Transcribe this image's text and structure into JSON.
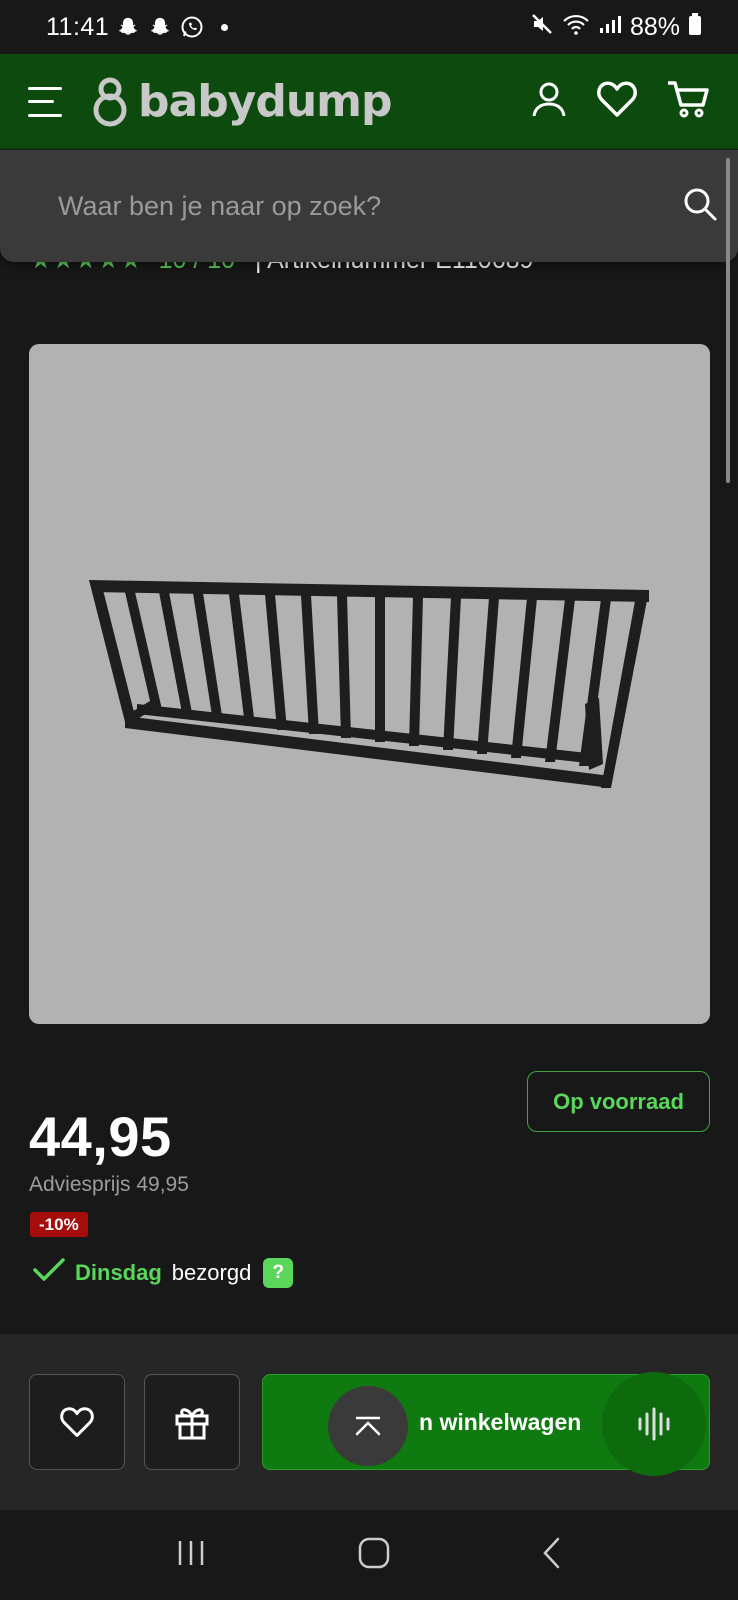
{
  "status_bar": {
    "time": "11:41",
    "battery": "88%"
  },
  "header": {
    "logo_text": "babydump",
    "brand_color": "#0d4a0d",
    "accent_color": "#5ad65a"
  },
  "search": {
    "placeholder": "Waar ben je naar op zoek?"
  },
  "product": {
    "stars": "★★★★★",
    "rating": "10 / 10",
    "article_number": "| Artikelnummer E110689",
    "image_alt": "bed rail",
    "stock": "Op voorraad",
    "price": "44,95",
    "advice_price": "Adviesprijs 49,95",
    "discount": "-10%",
    "delivery_day": "Dinsdag",
    "delivery_text": "bezorgd",
    "delivery_help": "?"
  },
  "actions": {
    "cart_label": "In winkelwagen",
    "cart_visible_label": "n winkelwagen"
  }
}
